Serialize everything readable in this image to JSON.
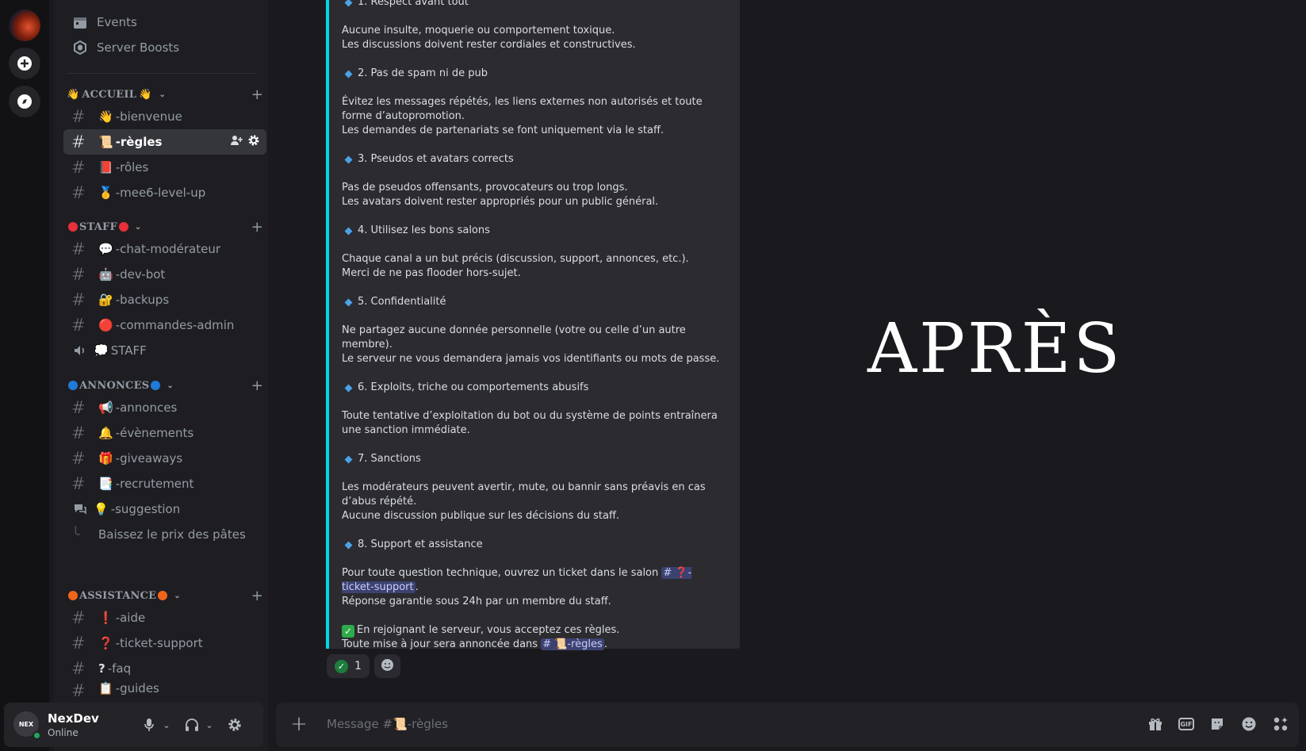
{
  "user": {
    "name": "NexDev",
    "status": "Online",
    "avatar_text": "NEX"
  },
  "sidebar": {
    "top_items": [
      {
        "label": "Events"
      },
      {
        "label": "Server Boosts"
      }
    ],
    "categories": [
      {
        "name": "ACCUEIL",
        "emoji_left": "👋",
        "emoji_right": "👋",
        "channels": [
          {
            "emoji": "👋",
            "label": "-bienvenue"
          },
          {
            "emoji": "📜",
            "label": "-règles",
            "active": true
          },
          {
            "emoji": "📕",
            "label": "-rôles"
          },
          {
            "emoji": "🥇",
            "label": "-mee6-level-up"
          }
        ]
      },
      {
        "name": "STAFF",
        "dot_color": "#e8303a",
        "channels": [
          {
            "emoji": "💬",
            "label": "-chat-modérateur"
          },
          {
            "emoji": "🤖",
            "label": "-dev-bot"
          },
          {
            "emoji": "🔐",
            "label": "-backups"
          },
          {
            "emoji": "🔴",
            "label": "-commandes-admin"
          },
          {
            "emoji": "💭",
            "label": "STAFF"
          }
        ]
      },
      {
        "name": "ANNONCES",
        "dot_color": "#1f7ad8",
        "channels": [
          {
            "emoji": "📢",
            "label": "-annonces"
          },
          {
            "emoji": "🔔",
            "label": "-évènements"
          },
          {
            "emoji": "🎁",
            "label": "-giveaways"
          },
          {
            "emoji": "📑",
            "label": "-recrutement"
          },
          {
            "emoji": "💡",
            "label": "-suggestion"
          },
          {
            "label": "Baissez le prix des pâtes"
          }
        ]
      },
      {
        "name": "ASSISTANCE",
        "dot_color": "#f0641c",
        "channels": [
          {
            "emoji": "❗",
            "label": "-aide"
          },
          {
            "emoji": "❓",
            "label": "-ticket-support"
          },
          {
            "emoji": "?",
            "label": "-faq"
          },
          {
            "emoji": "📋",
            "label": "-guides"
          }
        ]
      }
    ]
  },
  "embed": {
    "lines": {
      "r1_heading": "1. Respect avant tout",
      "r1_a": "Aucune insulte, moquerie ou comportement toxique.",
      "r1_b": "Les discussions doivent rester cordiales et constructives.",
      "r2_heading": "2. Pas de spam ni de pub",
      "r2_a": "Évitez les messages répétés, les liens externes non autorisés et toute forme d’autopromotion.",
      "r2_b": "Les demandes de partenariats se font uniquement via le staff.",
      "r3_heading": "3. Pseudos et avatars corrects",
      "r3_a": "Pas de pseudos offensants, provocateurs ou trop longs.",
      "r3_b": "Les avatars doivent rester appropriés pour un public général.",
      "r4_heading": "4. Utilisez les bons salons",
      "r4_a": "Chaque canal a un but précis (discussion, support, annonces, etc.).",
      "r4_b": "Merci de ne pas flooder hors-sujet.",
      "r5_heading": "5. Confidentialité",
      "r5_a": "Ne partagez aucune donnée personnelle (votre ou celle d’un autre membre).",
      "r5_b": "Le serveur ne vous demandera jamais vos identifiants ou mots de passe.",
      "r6_heading": "6. Exploits, triche ou comportements abusifs",
      "r6_a": "Toute tentative d’exploitation du bot ou du système de points entraînera une sanction immédiate.",
      "r7_heading": "7. Sanctions",
      "r7_a": "Les modérateurs peuvent avertir, mute, ou bannir sans préavis en cas d’abus répété.",
      "r7_b": "Aucune discussion publique sur les décisions du staff.",
      "r8_heading": "8. Support et assistance",
      "r8_a": "Pour toute question technique, ouvrez un ticket dans le salon",
      "r8_mention": "# ❓-ticket-support",
      "r8_b": "Réponse garantie sous 24h par un membre du staff.",
      "final_a": "En rejoignant le serveur, vous acceptez ces règles.",
      "final_b": "Toute mise à jour sera annoncée dans",
      "final_mention": "# 📜-règles"
    }
  },
  "reactions": [
    {
      "count": "1"
    }
  ],
  "overlay_title": "APRÈS",
  "composer": {
    "placeholder": "Message #📜-règles"
  },
  "colors": {
    "accent_bar": "#00d8e6",
    "mention_bg": "#3c4270",
    "online": "#23a55a"
  }
}
